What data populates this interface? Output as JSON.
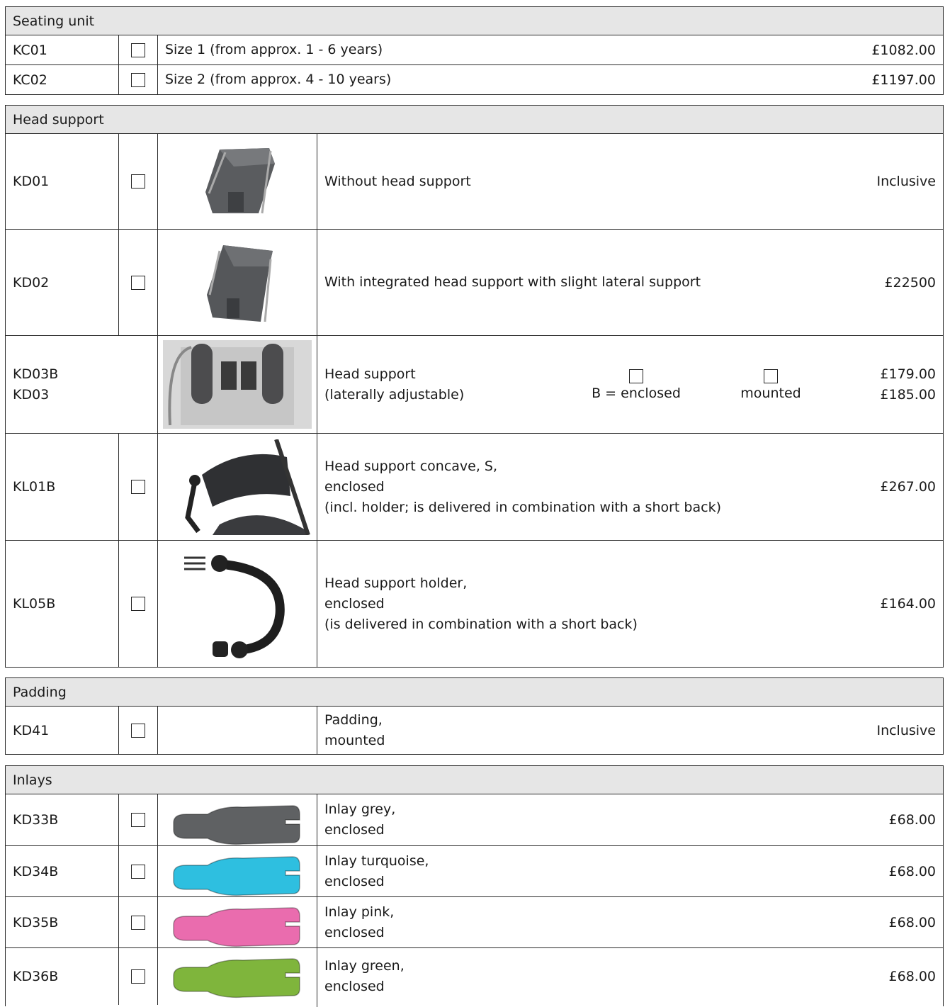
{
  "seating": {
    "title": "Seating unit",
    "rows": [
      {
        "code": "KC01",
        "desc": "Size 1 (from approx. 1 - 6 years)",
        "price": "£1082.00"
      },
      {
        "code": "KC02",
        "desc": "Size 2 (from approx. 4 - 10 years)",
        "price": "£1197.00"
      }
    ]
  },
  "head": {
    "title": "Head support",
    "kd01": {
      "code": "KD01",
      "desc": "Without head support",
      "price": "Inclusive"
    },
    "kd02": {
      "code": "KD02",
      "desc": "With integrated head support with slight lateral support",
      "price": "£22500"
    },
    "kd03": {
      "code1": "KD03B",
      "code2": "KD03",
      "desc1": "Head support",
      "desc2": "(laterally adjustable)",
      "opt1": "B = enclosed",
      "opt2": "mounted",
      "price1": "£179.00",
      "price2": "£185.00"
    },
    "kl01": {
      "code": "KL01B",
      "desc1": "Head support concave, S,",
      "desc2": "enclosed",
      "desc3": "(incl. holder; is delivered in combination with a short back)",
      "price": "£267.00"
    },
    "kl05": {
      "code": "KL05B",
      "desc1": "Head support holder,",
      "desc2": "enclosed",
      "desc3": "(is delivered in combination with a short back)",
      "price": "£164.00"
    }
  },
  "padding": {
    "title": "Padding",
    "row": {
      "code": "KD41",
      "desc1": "Padding,",
      "desc2": "mounted",
      "price": "Inclusive"
    }
  },
  "inlays": {
    "title": "Inlays",
    "rows": [
      {
        "code": "KD33B",
        "desc1": "Inlay grey,",
        "desc2": "enclosed",
        "price": "£68.00"
      },
      {
        "code": "KD34B",
        "desc1": "Inlay turquoise,",
        "desc2": "enclosed",
        "price": "£68.00"
      },
      {
        "code": "KD35B",
        "desc1": "Inlay pink,",
        "desc2": "enclosed",
        "price": "£68.00"
      },
      {
        "code": "KD36B",
        "desc1": "Inlay green,",
        "desc2": "enclosed",
        "price": "£68.00"
      }
    ],
    "colors": [
      "#5f6163",
      "#2ebfe0",
      "#ea6cae",
      "#7fb53c"
    ]
  }
}
